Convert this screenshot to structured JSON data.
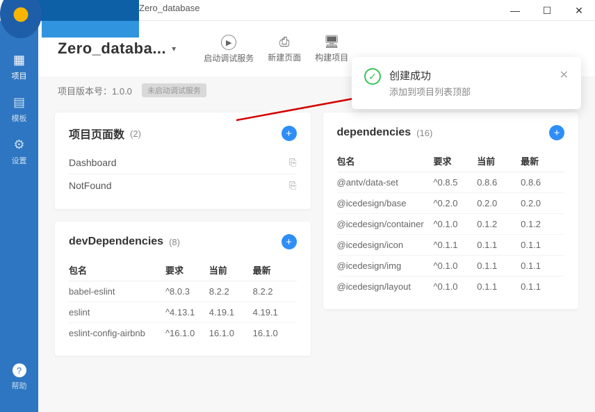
{
  "window": {
    "title": "Zero_database"
  },
  "sidebar": {
    "items": [
      {
        "label": "项目"
      },
      {
        "label": "模板"
      },
      {
        "label": "设置"
      }
    ],
    "help_label": "帮助"
  },
  "header": {
    "project_name": "Zero_databa...",
    "actions": [
      {
        "label": "启动调试服务"
      },
      {
        "label": "新建页面"
      },
      {
        "label": "构建项目"
      }
    ]
  },
  "subheader": {
    "version_label": "项目版本号：1.0.0",
    "debug_status": "未启动调试服务"
  },
  "cards": {
    "pages": {
      "title": "项目页面数",
      "count": "(2)",
      "rows": [
        "Dashboard",
        "NotFound"
      ]
    },
    "deps": {
      "title": "dependencies",
      "count": "(16)",
      "columns": [
        "包名",
        "要求",
        "当前",
        "最新"
      ],
      "rows": [
        {
          "name": "@antv/data-set",
          "req": "^0.8.5",
          "cur": "0.8.6",
          "latest": "0.8.6"
        },
        {
          "name": "@icedesign/base",
          "req": "^0.2.0",
          "cur": "0.2.0",
          "latest": "0.2.0"
        },
        {
          "name": "@icedesign/container",
          "req": "^0.1.0",
          "cur": "0.1.2",
          "latest": "0.1.2"
        },
        {
          "name": "@icedesign/icon",
          "req": "^0.1.1",
          "cur": "0.1.1",
          "latest": "0.1.1"
        },
        {
          "name": "@icedesign/img",
          "req": "^0.1.0",
          "cur": "0.1.1",
          "latest": "0.1.1"
        },
        {
          "name": "@icedesign/layout",
          "req": "^0.1.0",
          "cur": "0.1.1",
          "latest": "0.1.1"
        }
      ]
    },
    "devdeps": {
      "title": "devDependencies",
      "count": "(8)",
      "columns": [
        "包名",
        "要求",
        "当前",
        "最新"
      ],
      "rows": [
        {
          "name": "babel-eslint",
          "req": "^8.0.3",
          "cur": "8.2.2",
          "latest": "8.2.2"
        },
        {
          "name": "eslint",
          "req": "^4.13.1",
          "cur": "4.19.1",
          "latest": "4.19.1"
        },
        {
          "name": "eslint-config-airbnb",
          "req": "^16.1.0",
          "cur": "16.1.0",
          "latest": "16.1.0"
        }
      ]
    }
  },
  "toast": {
    "title": "创建成功",
    "message": "添加到项目列表顶部"
  }
}
